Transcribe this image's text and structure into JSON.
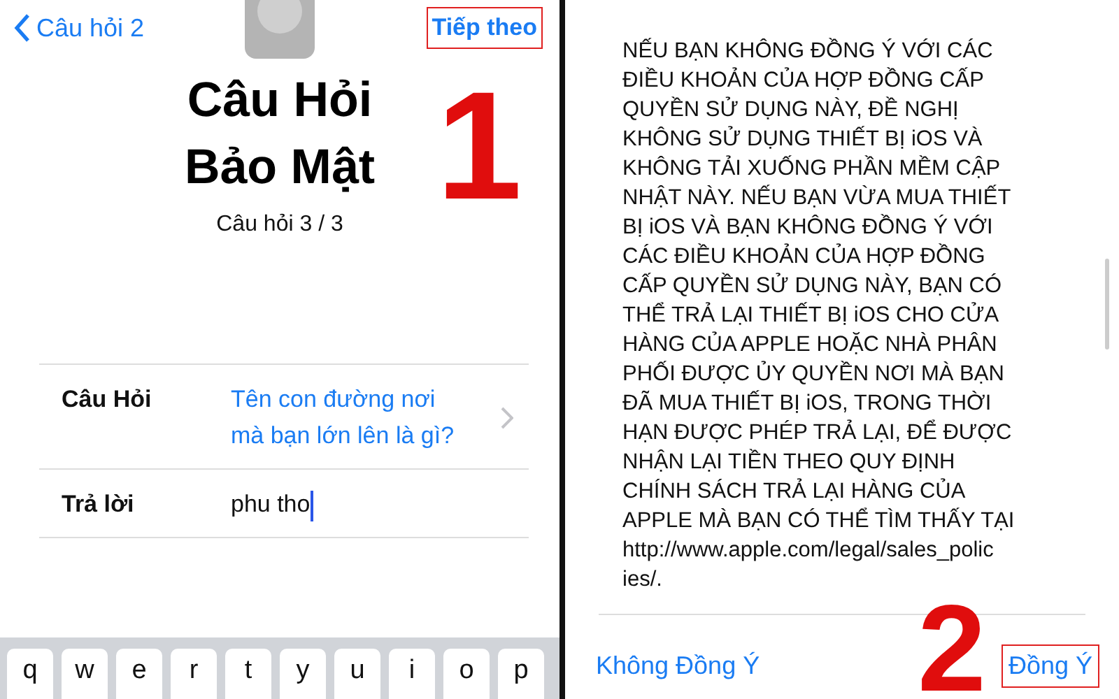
{
  "left_screen": {
    "nav": {
      "back": "Câu hỏi 2",
      "next": "Tiếp theo",
      "next_highlighted": true
    },
    "title_lines": [
      "Câu Hỏi",
      "Bảo Mật"
    ],
    "subtitle": "Câu hỏi 3 / 3",
    "form_rows": [
      {
        "label": "Câu Hỏi",
        "kind": "picker",
        "value_lines": [
          "Tên con đường nơi",
          "mà bạn lớn lên là gì?"
        ]
      },
      {
        "label": "Trả lời",
        "kind": "input",
        "value_lines": [
          "phu tho"
        ]
      }
    ],
    "keyboard_keys": [
      "q",
      "w",
      "e",
      "r",
      "t",
      "y",
      "u",
      "i",
      "o",
      "p"
    ],
    "step_marker": "1"
  },
  "right_screen": {
    "terms_lines": [
      "NẾU BẠN KHÔNG ĐỒNG Ý VỚI CÁC",
      "ĐIỀU KHOẢN CỦA HỢP ĐỒNG CẤP",
      "QUYỀN SỬ DỤNG NÀY, ĐỀ NGHỊ",
      "KHÔNG SỬ DỤNG THIẾT BỊ iOS VÀ",
      "KHÔNG TẢI XUỐNG PHẦN MỀM CẬP",
      "NHẬT NÀY. NẾU BẠN VỪA MUA THIẾT",
      "BỊ iOS VÀ BẠN KHÔNG ĐỒNG Ý VỚI",
      "CÁC ĐIỀU KHOẢN CỦA HỢP ĐỒNG",
      "CẤP QUYỀN SỬ DỤNG NÀY, BẠN CÓ",
      "THỂ TRẢ LẠI THIẾT BỊ iOS CHO CỬA",
      "HÀNG CỦA APPLE HOẶC NHÀ PHÂN",
      "PHỐI ĐƯỢC ỦY QUYỀN NƠI MÀ BẠN",
      "ĐÃ MUA THIẾT BỊ iOS, TRONG THỜI",
      "HẠN ĐƯỢC PHÉP TRẢ LẠI, ĐỂ ĐƯỢC",
      "NHẬN LẠI TIỀN THEO QUY ĐỊNH",
      "CHÍNH SÁCH TRẢ LẠI HÀNG CỦA",
      "APPLE MÀ BẠN CÓ THỂ TÌM THẤY TẠI",
      "http://www.apple.com/legal/sales_polic",
      "ies/."
    ],
    "buttons": [
      {
        "label": "Không Đồng Ý",
        "highlighted": false
      },
      {
        "label": "Đồng Ý",
        "highlighted": true
      }
    ],
    "step_marker": "2"
  }
}
